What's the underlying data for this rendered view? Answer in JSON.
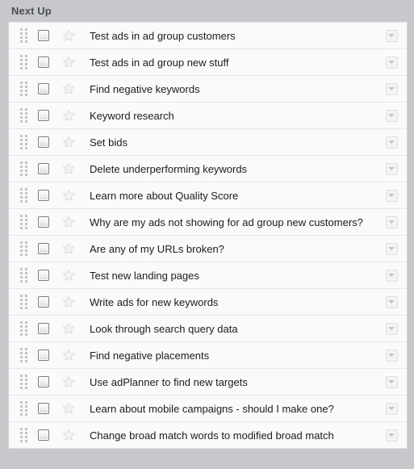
{
  "panel": {
    "title": "Next Up",
    "header_bg": "#c7c8cc",
    "row_bg": "#fafafb",
    "row_border": "#e6e7e9",
    "text_color": "#1c1c1c"
  },
  "row_controls": {
    "drag_handle_name": "drag-handle-icon",
    "checkbox_name": "task-checkbox",
    "checkbox_checked": false,
    "star_name": "star-icon",
    "star_filled": false,
    "menu_name": "row-menu-button",
    "menu_glyph": "chevron-down-icon"
  },
  "tasks": [
    {
      "label": "Test ads in ad group customers"
    },
    {
      "label": "Test ads in ad group new stuff"
    },
    {
      "label": "Find negative keywords"
    },
    {
      "label": "Keyword research"
    },
    {
      "label": "Set bids"
    },
    {
      "label": "Delete underperforming keywords"
    },
    {
      "label": "Learn more about Quality Score"
    },
    {
      "label": "Why are my ads not showing for ad group new customers?"
    },
    {
      "label": "Are any of my URLs broken?"
    },
    {
      "label": "Test new landing pages"
    },
    {
      "label": "Write ads for new keywords"
    },
    {
      "label": "Look through search query data"
    },
    {
      "label": "Find negative placements"
    },
    {
      "label": "Use adPlanner to find new targets"
    },
    {
      "label": "Learn about mobile campaigns - should I make one?"
    },
    {
      "label": "Change broad match words to modified broad match"
    }
  ]
}
